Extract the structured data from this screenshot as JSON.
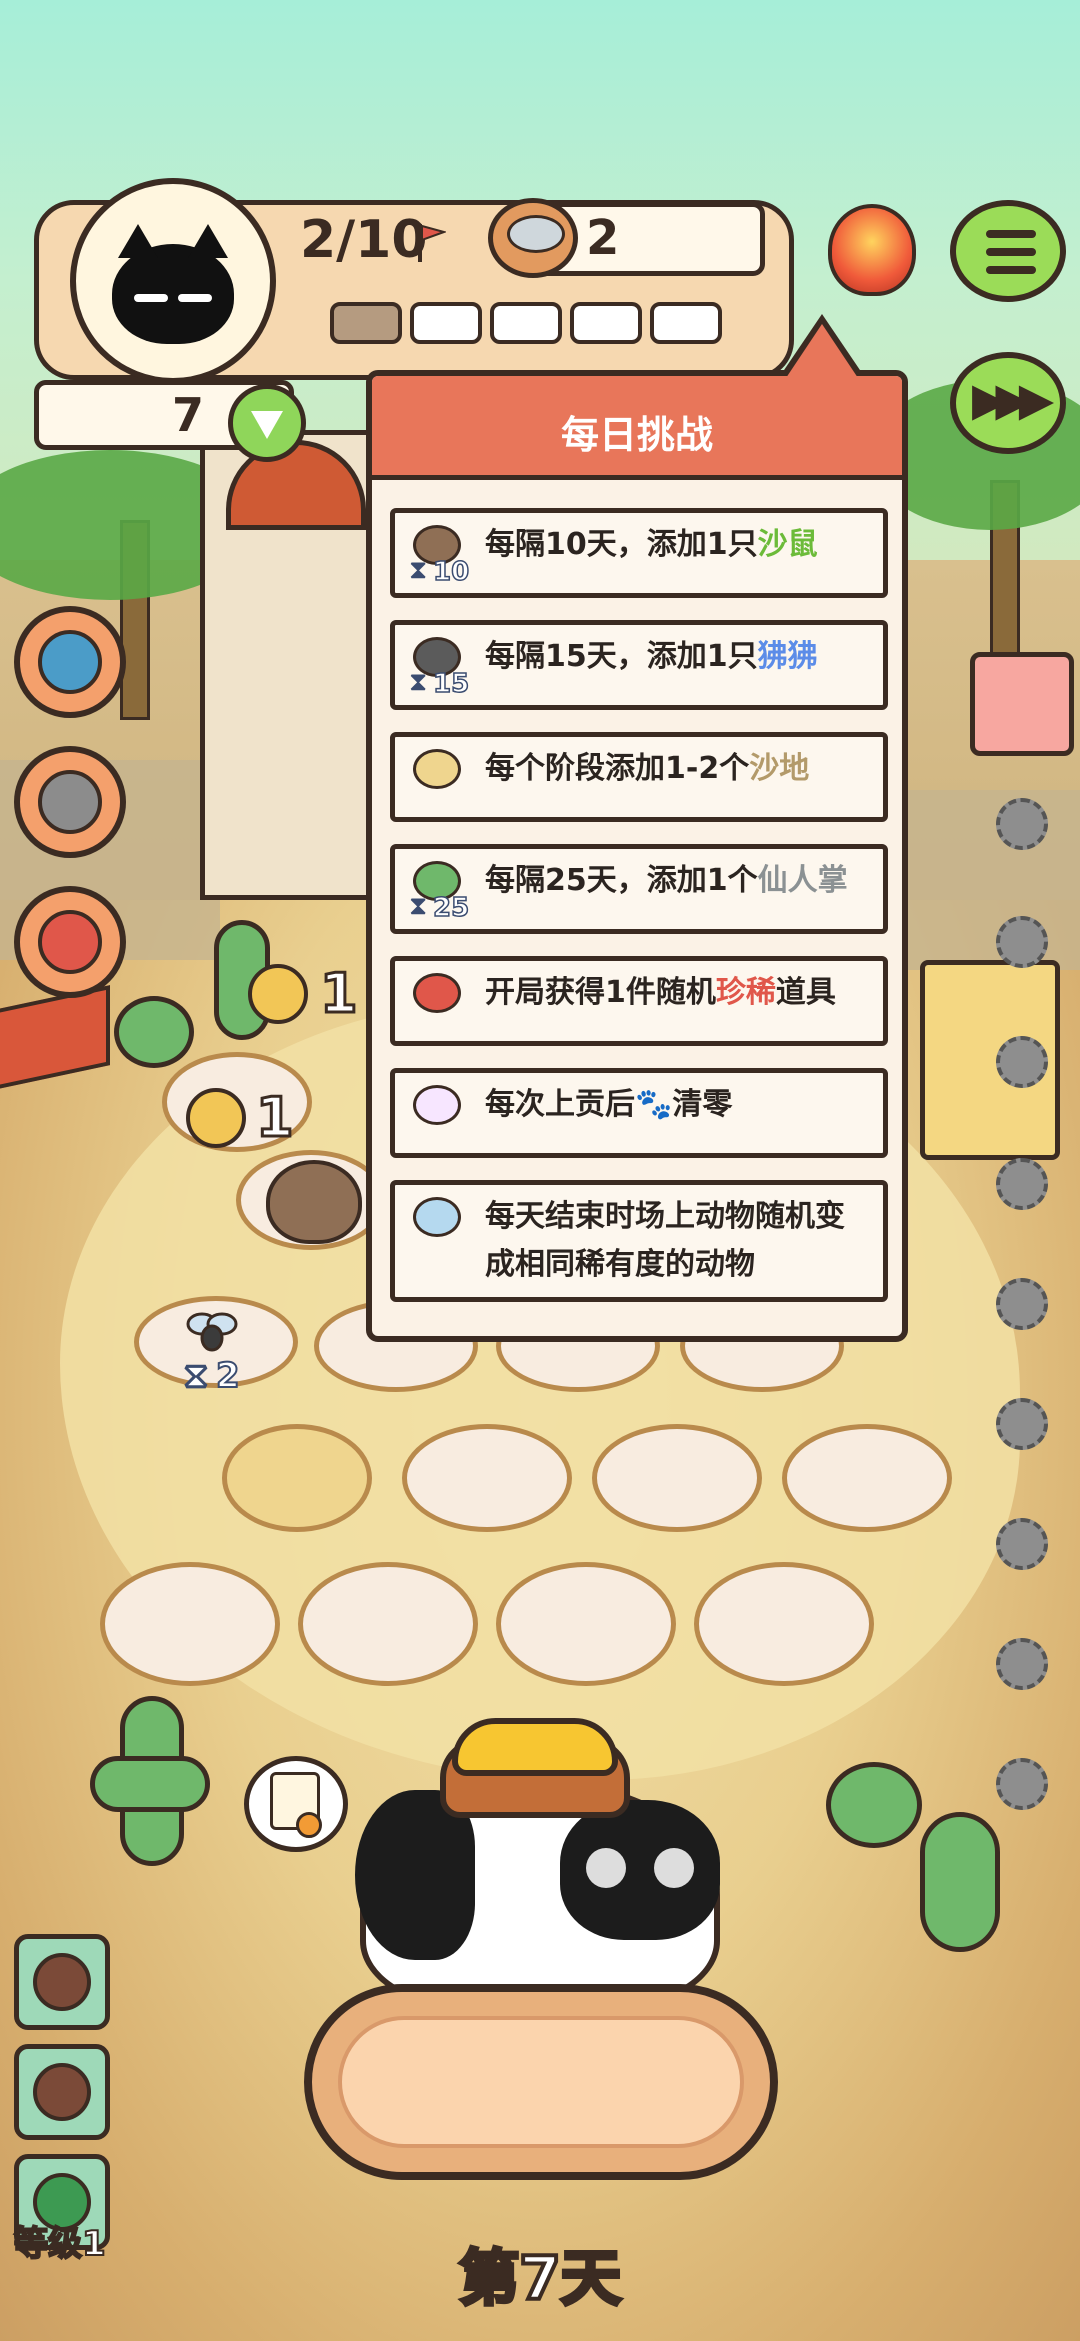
{
  "hud": {
    "progress": "2/10",
    "coins": "2",
    "hearts": "7",
    "stage_segments_filled": 1,
    "stage_segments_total": 5
  },
  "popup": {
    "title": "每日挑战",
    "items": [
      {
        "icon": "hamster-icon",
        "timer": "10",
        "parts": [
          [
            "每隔10天，添加1只",
            ""
          ],
          [
            "沙鼠",
            "green"
          ]
        ]
      },
      {
        "icon": "monkey-icon",
        "timer": "15",
        "parts": [
          [
            "每隔15天，添加1只",
            ""
          ],
          [
            "狒狒",
            "blue"
          ]
        ]
      },
      {
        "icon": "sand-flag-icon",
        "timer": "",
        "parts": [
          [
            "每个阶段添加1-2个",
            ""
          ],
          [
            "沙地",
            "tan"
          ]
        ]
      },
      {
        "icon": "cactus-icon",
        "timer": "25",
        "parts": [
          [
            "每隔25天，添加1个",
            ""
          ],
          [
            "仙人掌",
            "grey"
          ]
        ]
      },
      {
        "icon": "gift-box-icon",
        "timer": "",
        "parts": [
          [
            "开局获得1件随机",
            ""
          ],
          [
            "珍稀",
            "red"
          ],
          [
            "道具",
            ""
          ]
        ]
      },
      {
        "icon": "offering-icon",
        "timer": "",
        "parts": [
          [
            "每次上贡后",
            ""
          ],
          [
            "🐾",
            ""
          ],
          [
            "清零",
            ""
          ]
        ]
      },
      {
        "icon": "transform-icon",
        "timer": "",
        "parts": [
          [
            "每天结束时场上动物随机变成相同稀有度的动物",
            ""
          ]
        ]
      }
    ]
  },
  "board": {
    "paw_count_1": "1",
    "paw_count_2": "1",
    "mosquito_timer": "2"
  },
  "footer": {
    "day": "第7天",
    "level": "等级1"
  },
  "colors": {
    "header": "#e8765a",
    "outline": "#3b2b22",
    "green_text": "#6cbb39",
    "blue_text": "#5c8ce8",
    "red_text": "#e0574a"
  }
}
